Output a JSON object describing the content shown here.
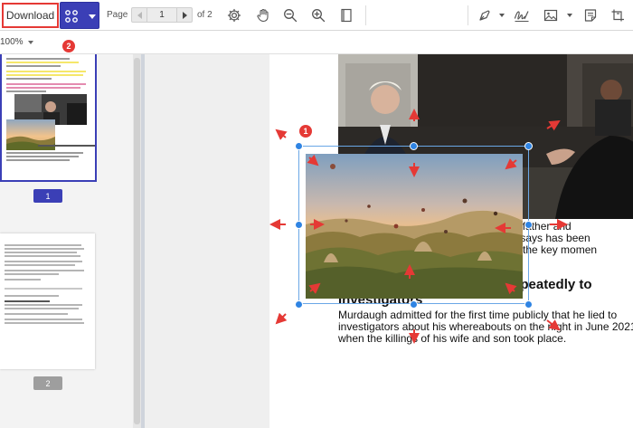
{
  "toolbar": {
    "download_label": "Download",
    "page_label": "Page",
    "current_page": "1",
    "page_total": "of 2",
    "step_badge_2": "2"
  },
  "zoom": {
    "value": "100%"
  },
  "sidebar": {
    "thumbnails": [
      {
        "number": "1",
        "selected": true,
        "badge_color": "#3b3fb6"
      },
      {
        "number": "2",
        "selected": false,
        "badge_color": "#9e9e9e"
      }
    ]
  },
  "document": {
    "step_badge_1": "1",
    "partial_lines": [
      "loving father and",
      "r what it says has been",
      "some of the key momen"
    ],
    "heading_partial": "epeatedly to",
    "heading_line2": "Investigators",
    "body_lines": [
      "Murdaugh admitted for the first time publicly that he lied to",
      "investigators about his whereabouts on the night in June 2021",
      "when the killings of his wife and son took place."
    ]
  },
  "colors": {
    "accent": "#3b3fb6",
    "annotation_red": "#e53935",
    "selection_blue": "#2f84e3"
  }
}
